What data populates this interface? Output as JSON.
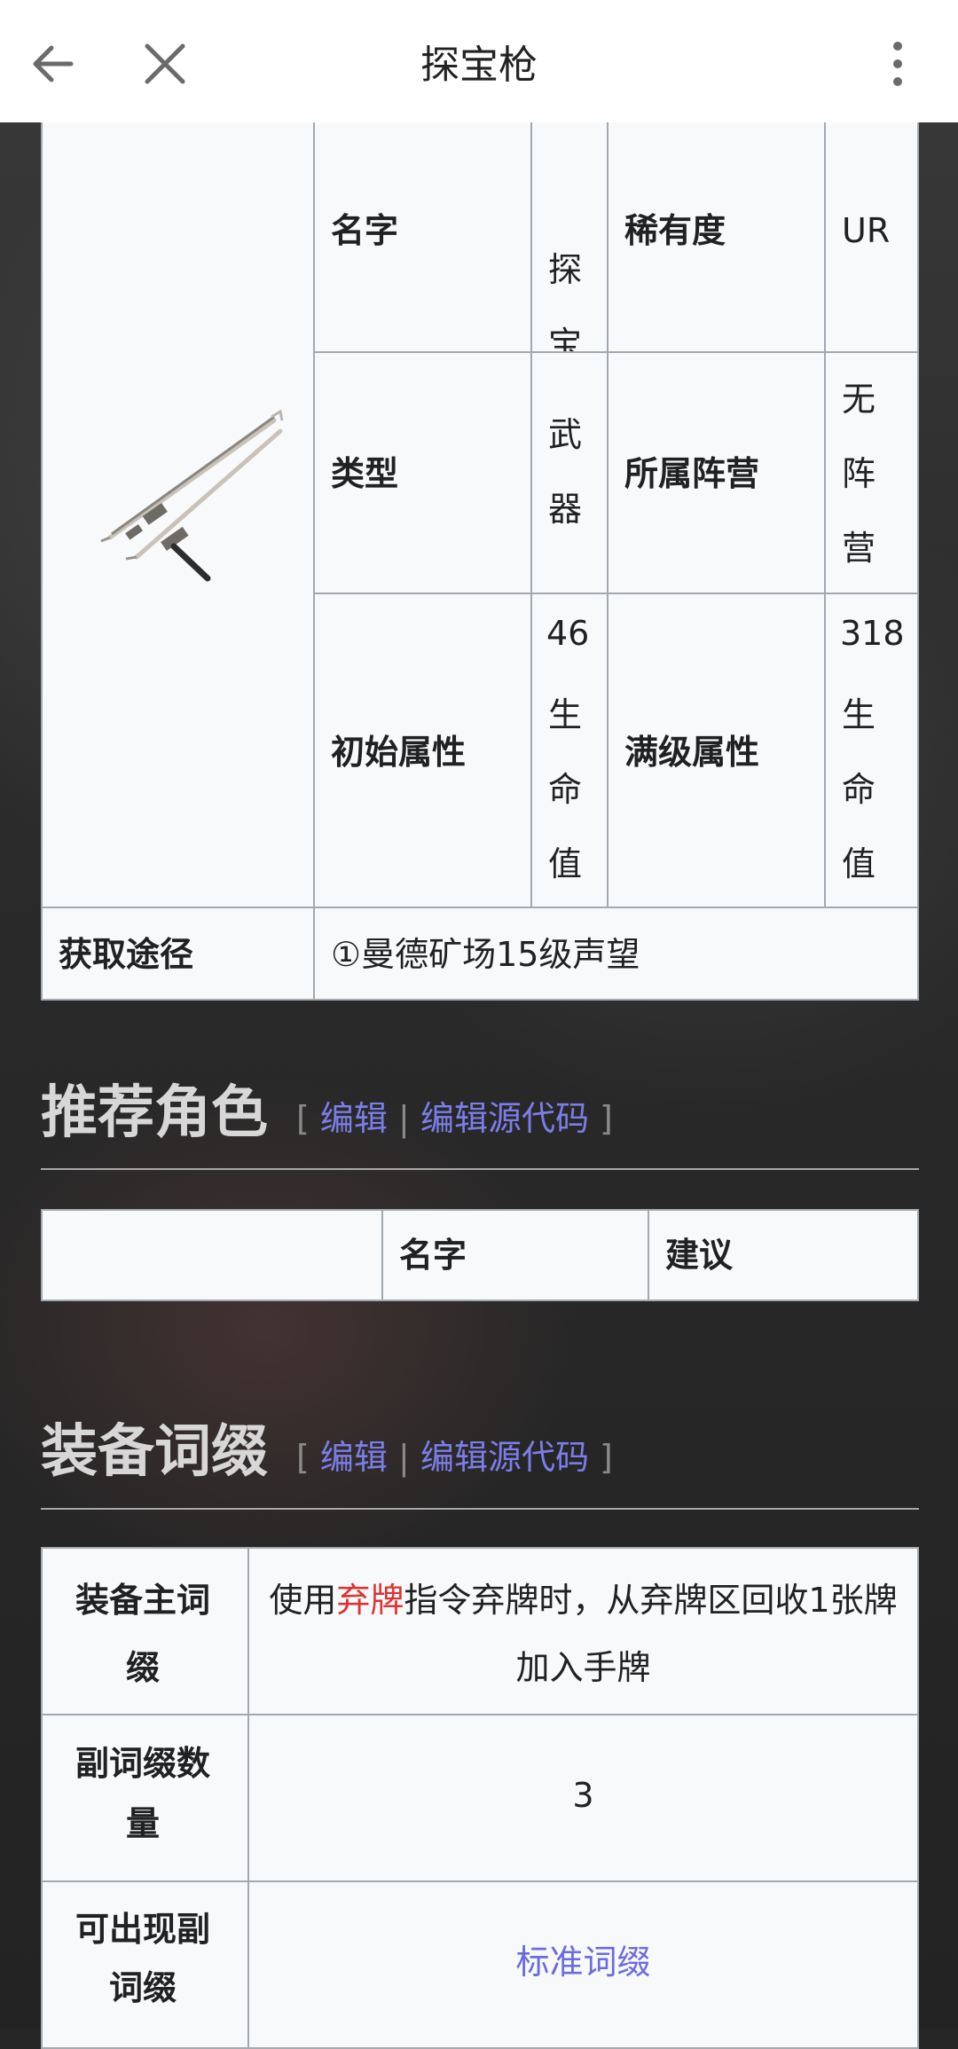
{
  "topbar": {
    "title": "探宝枪",
    "back_icon": "arrow-left-icon",
    "close_icon": "close-icon",
    "more_icon": "more-vertical-icon"
  },
  "infobox": {
    "name_label": "名字",
    "name_value": "探宝枪",
    "rarity_label": "稀有度",
    "rarity_value": "UR",
    "type_label": "类型",
    "type_value": "武器",
    "faction_label": "所属阵营",
    "faction_value": "无阵营",
    "init_label": "初始属性",
    "init_value_num": "46",
    "init_value_text": "生命值",
    "max_label": "满级属性",
    "max_value_num": "318",
    "max_value_text": "生命值",
    "source_label": "获取途径",
    "source_value": "①曼德矿场15级声望"
  },
  "section_recommend": {
    "title": "推荐角色",
    "edit": "编辑",
    "edit_source": "编辑源代码",
    "bracket_open": "[",
    "bracket_close": "]",
    "separator": "|",
    "col_name": "名字",
    "col_advice": "建议"
  },
  "section_affix": {
    "title": "装备词缀",
    "edit": "编辑",
    "edit_source": "编辑源代码",
    "bracket_open": "[",
    "bracket_close": "]",
    "separator": "|",
    "main_label": "装备主词缀",
    "main_text_pre": "使用",
    "main_text_link": "弃牌",
    "main_text_post": "指令弃牌时，从弃牌区回收1张牌加入手牌",
    "sub_count_label": "副词缀数量",
    "sub_count_value": "3",
    "avail_label": "可出现副词缀",
    "avail_value": "标准词缀"
  }
}
